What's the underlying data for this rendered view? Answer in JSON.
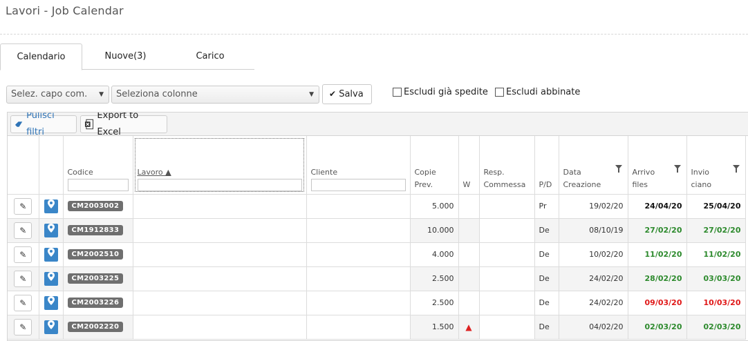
{
  "page": {
    "title": "Lavori - Job Calendar"
  },
  "tabs": [
    {
      "label": "Calendario",
      "active": true
    },
    {
      "label": "Nuove(3)",
      "active": false
    },
    {
      "label": "Carico",
      "active": false
    }
  ],
  "toolbar": {
    "capo_select": "Selez. capo com.",
    "columns_select": "Seleziona colonne",
    "save_label": "Salva",
    "exclude_shipped": "Escludi già spedite",
    "exclude_matched": "Escludi abbinate"
  },
  "grid_toolbar": {
    "clear_filters": "Pulisci filtri",
    "export_excel": "Export to Excel"
  },
  "columns": {
    "codice": "Codice",
    "lavoro": "Lavoro ▲",
    "cliente": "Cliente",
    "copie_1": "Copie",
    "copie_2": "Prev.",
    "w": "W",
    "resp_1": "Resp.",
    "resp_2": "Commessa",
    "pd": "P/D",
    "data_1": "Data",
    "data_2": "Creazione",
    "arrivo_1": "Arrivo",
    "arrivo_2": "files",
    "invio_1": "Invio",
    "invio_2": "ciano"
  },
  "rows": [
    {
      "code": "CM2003002",
      "copies": "5.000",
      "warn": false,
      "pd": "Pr",
      "created": "19/02/20",
      "arrival": "24/04/20",
      "arrival_color": "black",
      "send": "25/04/20",
      "send_color": "black"
    },
    {
      "code": "CM1912833",
      "copies": "10.000",
      "warn": false,
      "pd": "De",
      "created": "08/10/19",
      "arrival": "27/02/20",
      "arrival_color": "green",
      "send": "27/02/20",
      "send_color": "green"
    },
    {
      "code": "CM2002510",
      "copies": "4.000",
      "warn": false,
      "pd": "De",
      "created": "10/02/20",
      "arrival": "11/02/20",
      "arrival_color": "green",
      "send": "11/02/20",
      "send_color": "green"
    },
    {
      "code": "CM2003225",
      "copies": "2.500",
      "warn": false,
      "pd": "De",
      "created": "24/02/20",
      "arrival": "28/02/20",
      "arrival_color": "green",
      "send": "03/03/20",
      "send_color": "green"
    },
    {
      "code": "CM2003226",
      "copies": "2.500",
      "warn": false,
      "pd": "De",
      "created": "24/02/20",
      "arrival": "09/03/20",
      "arrival_color": "red",
      "send": "10/03/20",
      "send_color": "red"
    },
    {
      "code": "CM2002220",
      "copies": "1.500",
      "warn": true,
      "pd": "De",
      "created": "04/02/20",
      "arrival": "02/03/20",
      "arrival_color": "green",
      "send": "02/03/20",
      "send_color": "green"
    }
  ],
  "icons": {
    "edit": "pencil-icon",
    "pin": "map-pin-icon",
    "warning": "warning-icon",
    "check": "check-icon",
    "eraser": "eraser-icon",
    "excel": "excel-icon",
    "filter": "filter-funnel-icon"
  },
  "colors": {
    "accent": "#3a86c8",
    "green": "#2d8a2d",
    "red": "#e01818",
    "badge": "#6f6f6f"
  }
}
